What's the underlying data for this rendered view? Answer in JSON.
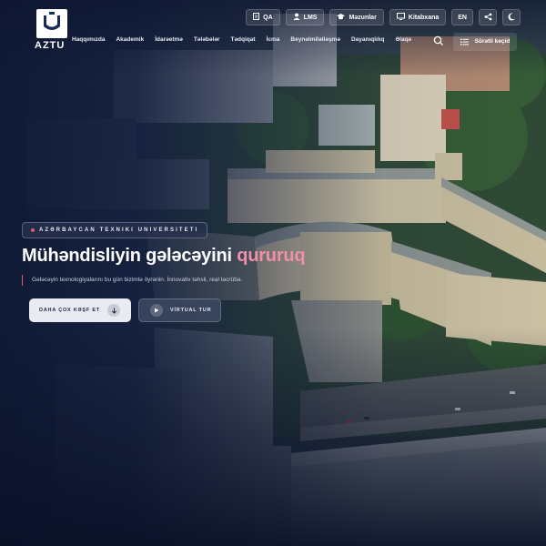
{
  "logo": {
    "text": "AZTU",
    "icon": "aztu-shield-logo"
  },
  "topbar": {
    "qa": {
      "label": "QA",
      "icon": "document-icon"
    },
    "lms": {
      "label": "LMS",
      "icon": "user-icon"
    },
    "alumni": {
      "label": "Məzunlar",
      "icon": "graduation-cap-icon"
    },
    "library": {
      "label": "Kitabxana",
      "icon": "monitor-icon"
    },
    "lang": {
      "label": "EN"
    },
    "share": {
      "icon": "share-icon"
    },
    "theme": {
      "icon": "moon-icon"
    }
  },
  "nav": {
    "items": [
      "Haqqımızda",
      "Akademik",
      "İdarəetmə",
      "Tələbələr",
      "Tədqiqat",
      "İcma",
      "Beynəlmiləlləşmə",
      "Dayanıqlılıq",
      "Əlaqə"
    ],
    "search_icon": "search-icon",
    "quick_access": {
      "label": "Sürətli keçid",
      "icon": "list-icon"
    }
  },
  "hero": {
    "tag": "Azərbaycan Texniki Universiteti",
    "headline_main": "Mühəndisliyin gələcəyini",
    "headline_accent": "qururuq",
    "subtitle": "Gələcəyin texnologiyalarını bu gün bizimlə öyrənin. İnnovativ təhsil, real təcrübə.",
    "primary_button": {
      "label": "DAHA ÇOX KƏŞF ET",
      "icon": "arrow-down-icon"
    },
    "secondary_button": {
      "label": "VİRTUAL TUR",
      "icon": "play-icon"
    }
  },
  "colors": {
    "background": "#0f1a33",
    "accent_pink": "#f08fa8",
    "accent_red": "#e05a6a",
    "button_light": "#e9ebf2"
  }
}
